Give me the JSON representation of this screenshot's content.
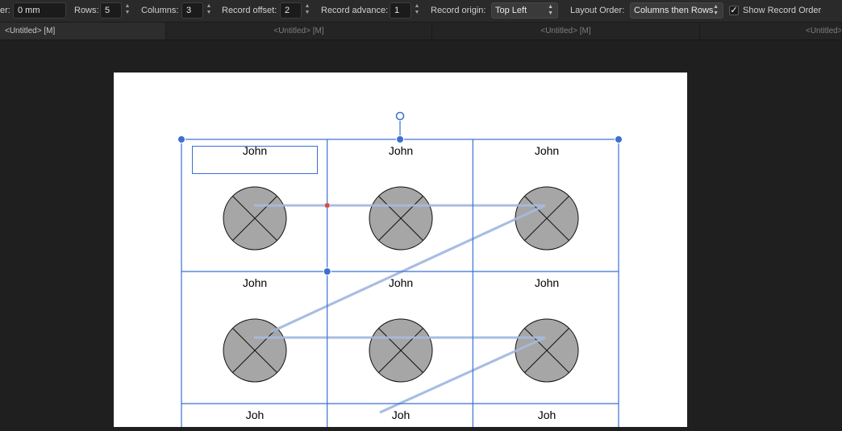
{
  "toolbar": {
    "gutter_label": "er:",
    "gutter_value": "0 mm",
    "rows_label": "Rows:",
    "rows_value": "5",
    "columns_label": "Columns:",
    "columns_value": "3",
    "record_offset_label": "Record offset:",
    "record_offset_value": "2",
    "record_advance_label": "Record advance:",
    "record_advance_value": "1",
    "record_origin_label": "Record origin:",
    "record_origin_value": "Top Left",
    "layout_order_label": "Layout Order:",
    "layout_order_value": "Columns then Rows",
    "show_record_order_label": "Show Record Order",
    "show_record_order_checked": "✓"
  },
  "tabs": [
    {
      "label": "<Untitled> [M]",
      "active": true
    },
    {
      "label": "<Untitled> [M]",
      "active": false
    },
    {
      "label": "<Untitled> [M]",
      "active": false
    },
    {
      "label": "<Untitled>",
      "active": false
    }
  ],
  "grid": {
    "cell_text": [
      "John",
      "John",
      "John",
      "John",
      "John",
      "John"
    ],
    "partial_row_text": [
      "Joh",
      "Joh",
      "Joh"
    ]
  },
  "colors": {
    "selection": "#3b6fd4",
    "order_line": "#a8bde3",
    "placeholder_fill": "#a6a6a6",
    "anchor_dot": "#e0443a"
  }
}
